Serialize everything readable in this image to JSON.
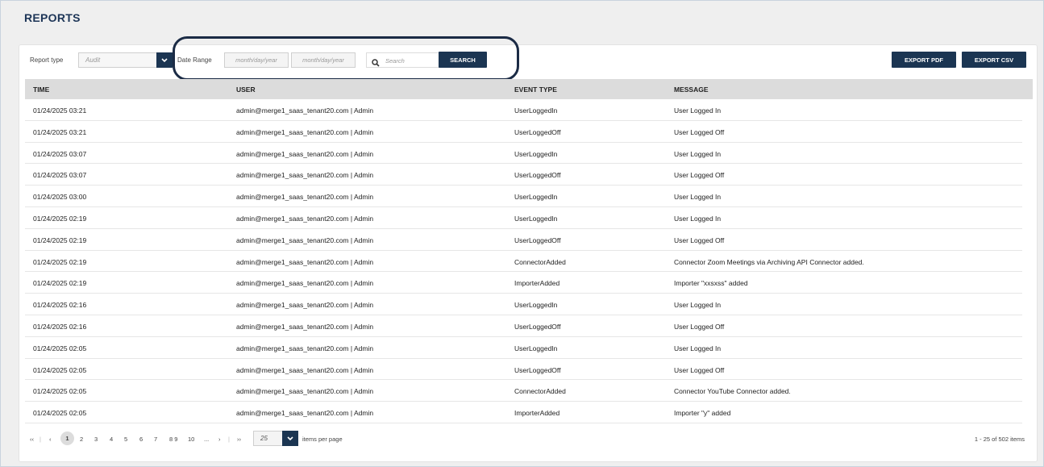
{
  "header": {
    "title": "REPORTS"
  },
  "filters": {
    "report_type_label": "Report type",
    "report_type_value": "Audit",
    "date_range_label": "Date Range",
    "date_from_placeholder": "month/day/year",
    "date_to_placeholder": "month/day/year",
    "search_placeholder": "Search",
    "search_button": "SEARCH"
  },
  "actions": {
    "export_pdf": "EXPORT PDF",
    "export_csv": "EXPORT CSV"
  },
  "table": {
    "columns": [
      "TIME",
      "USER",
      "EVENT TYPE",
      "MESSAGE"
    ],
    "rows": [
      [
        "01/24/2025 03:21",
        "admin@merge1_saas_tenant20.com | Admin",
        "UserLoggedIn",
        "User Logged In"
      ],
      [
        "01/24/2025 03:21",
        "admin@merge1_saas_tenant20.com | Admin",
        "UserLoggedOff",
        "User Logged Off"
      ],
      [
        "01/24/2025 03:07",
        "admin@merge1_saas_tenant20.com | Admin",
        "UserLoggedIn",
        "User Logged In"
      ],
      [
        "01/24/2025 03:07",
        "admin@merge1_saas_tenant20.com | Admin",
        "UserLoggedOff",
        "User Logged Off"
      ],
      [
        "01/24/2025 03:00",
        "admin@merge1_saas_tenant20.com | Admin",
        "UserLoggedIn",
        "User Logged In"
      ],
      [
        "01/24/2025 02:19",
        "admin@merge1_saas_tenant20.com | Admin",
        "UserLoggedIn",
        "User Logged In"
      ],
      [
        "01/24/2025 02:19",
        "admin@merge1_saas_tenant20.com | Admin",
        "UserLoggedOff",
        "User Logged Off"
      ],
      [
        "01/24/2025 02:19",
        "admin@merge1_saas_tenant20.com | Admin",
        "ConnectorAdded",
        "Connector Zoom Meetings via Archiving API Connector added."
      ],
      [
        "01/24/2025 02:19",
        "admin@merge1_saas_tenant20.com | Admin",
        "ImporterAdded",
        "Importer \"xxsxss\" added"
      ],
      [
        "01/24/2025 02:16",
        "admin@merge1_saas_tenant20.com | Admin",
        "UserLoggedIn",
        "User Logged In"
      ],
      [
        "01/24/2025 02:16",
        "admin@merge1_saas_tenant20.com | Admin",
        "UserLoggedOff",
        "User Logged Off"
      ],
      [
        "01/24/2025 02:05",
        "admin@merge1_saas_tenant20.com | Admin",
        "UserLoggedIn",
        "User Logged In"
      ],
      [
        "01/24/2025 02:05",
        "admin@merge1_saas_tenant20.com | Admin",
        "UserLoggedOff",
        "User Logged Off"
      ],
      [
        "01/24/2025 02:05",
        "admin@merge1_saas_tenant20.com | Admin",
        "ConnectorAdded",
        "Connector YouTube Connector added."
      ],
      [
        "01/24/2025 02:05",
        "admin@merge1_saas_tenant20.com | Admin",
        "ImporterAdded",
        "Importer \"y\" added"
      ]
    ]
  },
  "pagination": {
    "first": "‹‹",
    "prev": "‹",
    "pages": [
      "1",
      "2",
      "3",
      "4",
      "5",
      "6",
      "7",
      "8 9",
      "10",
      "..."
    ],
    "next": "›",
    "last": "››",
    "page_size": "25",
    "per_page_label": "items per page",
    "summary": "1 - 25 of 502 items"
  },
  "colors": {
    "primary": "#1b3552",
    "title": "#1d3557",
    "header_bg": "#dcdcdc"
  }
}
